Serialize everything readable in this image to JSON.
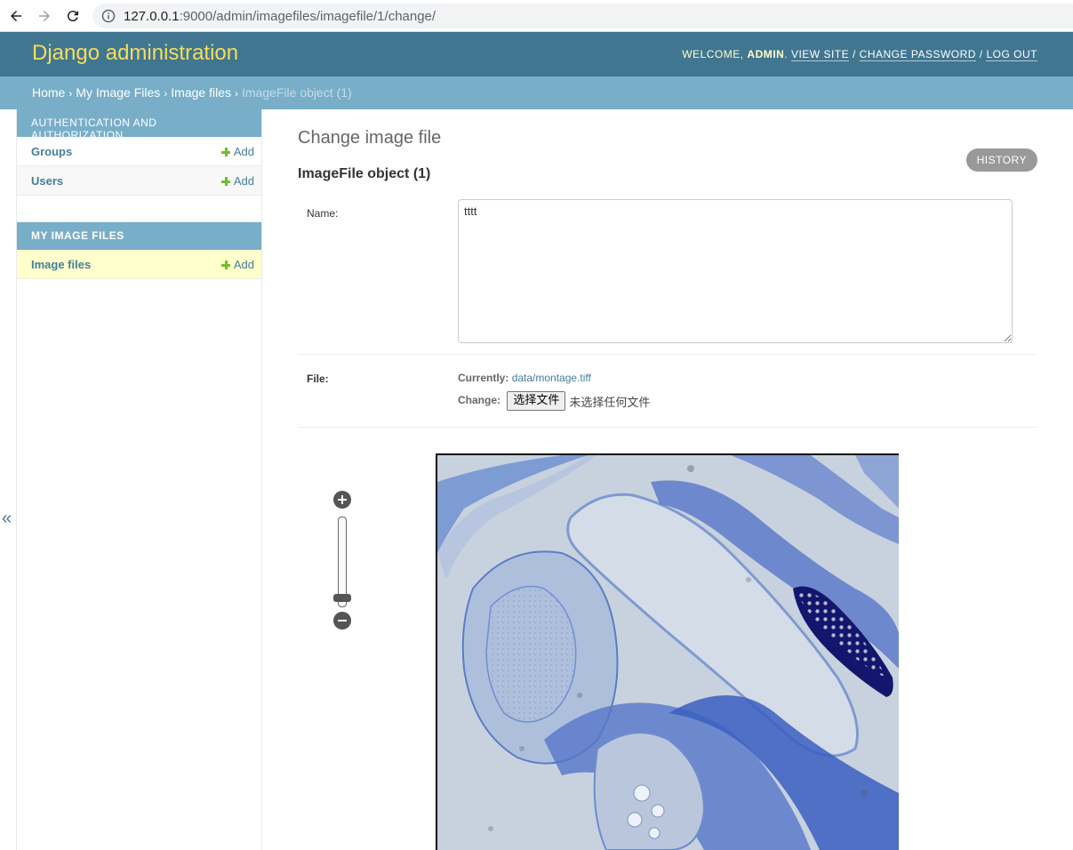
{
  "browser": {
    "url_host": "127.0.0.1",
    "url_path": ":9000/admin/imagefiles/imagefile/1/change/"
  },
  "header": {
    "branding": "Django administration",
    "welcome": "Welcome,",
    "username": "admin",
    "view_site": "View site",
    "change_password": "Change password",
    "log_out": "Log out"
  },
  "breadcrumbs": {
    "home": "Home",
    "app": "My Image Files",
    "model": "Image files",
    "current": "ImageFile object (1)"
  },
  "sidebar": {
    "modules": [
      {
        "caption": "Authentication and Authorization",
        "rows": [
          {
            "label": "Groups",
            "add": "Add"
          },
          {
            "label": "Users",
            "add": "Add"
          }
        ]
      },
      {
        "caption": "My Image Files",
        "rows": [
          {
            "label": "Image files",
            "add": "Add"
          }
        ]
      }
    ],
    "collapse_glyph": "«"
  },
  "content": {
    "page_title": "Change image file",
    "history": "History",
    "object_title": "ImageFile object (1)",
    "name_label": "Name:",
    "name_value": "tttt",
    "file_label": "File:",
    "currently_label": "Currently:",
    "currently_value": "data/montage.tiff",
    "change_label": "Change:",
    "choose_file": "选择文件",
    "no_file": "未选择任何文件"
  },
  "viewer": {
    "zoom_level": 0.08
  },
  "colors": {
    "header_bg": "#417690",
    "breadcrumb_bg": "#79aec8",
    "branding": "#f5dd5d",
    "link": "#447e9b",
    "add_icon": "#70bf2b",
    "selected_row": "#ffffcc"
  }
}
